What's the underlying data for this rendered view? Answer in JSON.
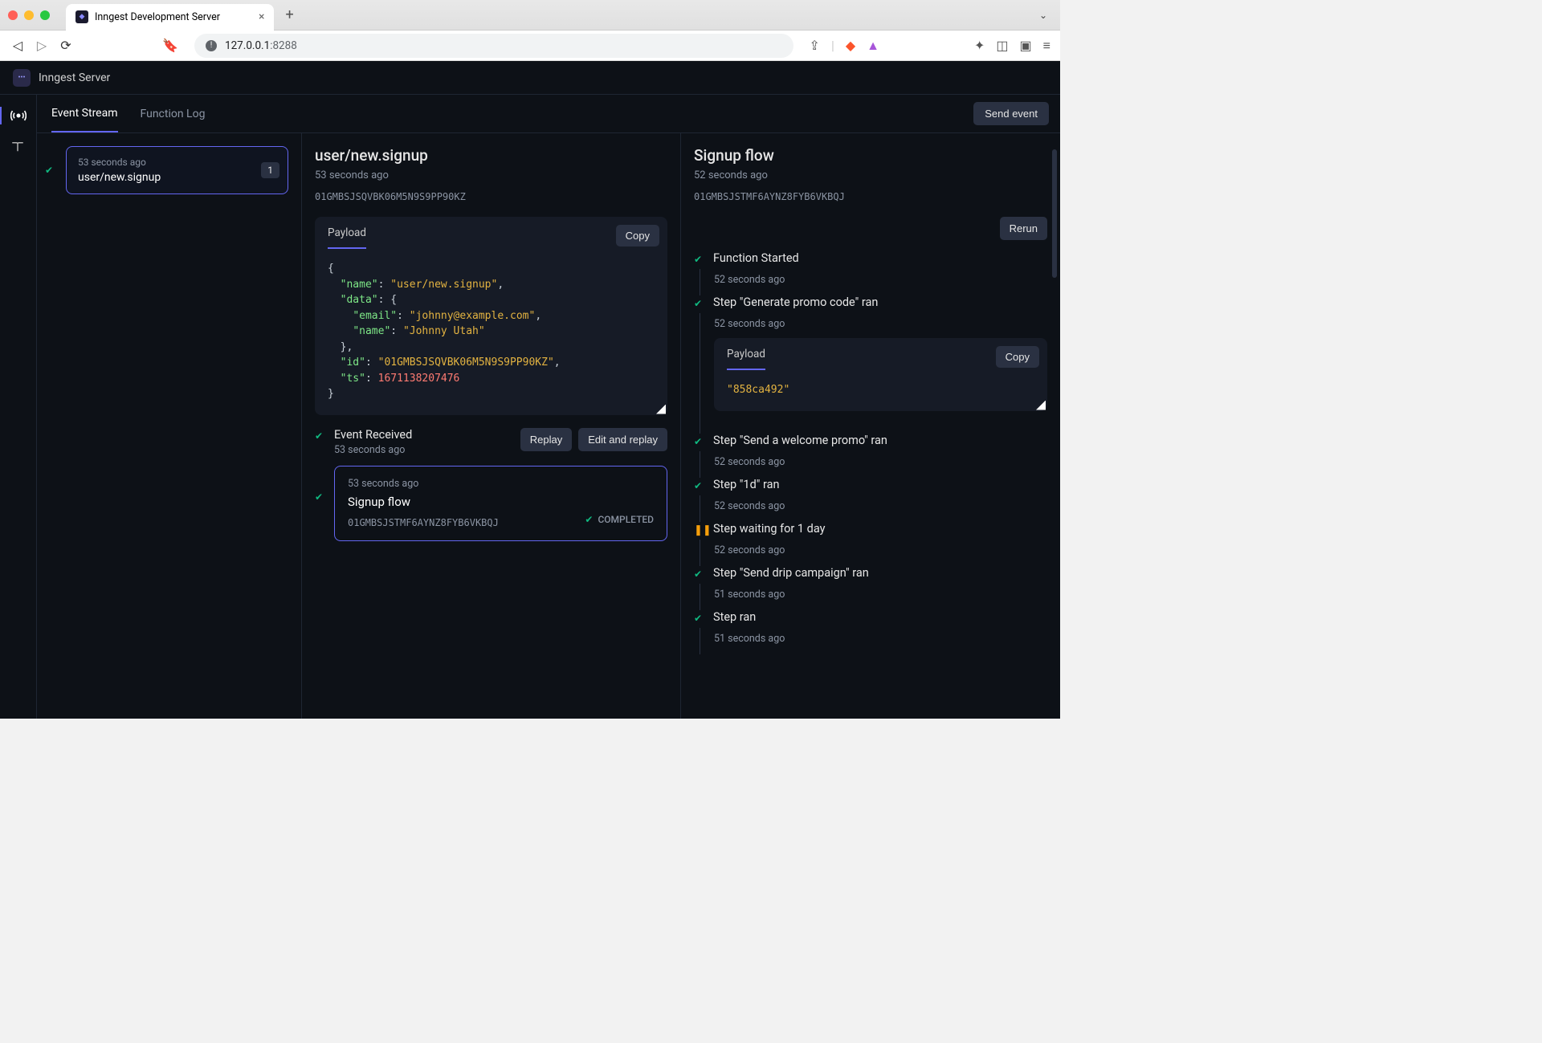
{
  "browser": {
    "tab_title": "Inngest Development Server",
    "url_host": "127.0.0.1",
    "url_port": ":8288"
  },
  "app": {
    "title": "Inngest Server",
    "tabs": {
      "events": "Event Stream",
      "functions": "Function Log"
    },
    "send_event": "Send event"
  },
  "event_list": {
    "item": {
      "time": "53 seconds ago",
      "name": "user/new.signup",
      "count": "1"
    }
  },
  "event_panel": {
    "title": "user/new.signup",
    "time": "53 seconds ago",
    "id": "01GMBSJSQVBK06M5N9S9PP90KZ",
    "code_tab": "Payload",
    "copy": "Copy",
    "payload": {
      "name_key": "\"name\"",
      "name_val": "\"user/new.signup\"",
      "data_key": "\"data\"",
      "email_key": "\"email\"",
      "email_val": "\"johnny@example.com\"",
      "pname_key": "\"name\"",
      "pname_val": "\"Johnny Utah\"",
      "id_key": "\"id\"",
      "id_val": "\"01GMBSJSQVBK06M5N9S9PP90KZ\"",
      "ts_key": "\"ts\"",
      "ts_val": "1671138207476"
    },
    "received": {
      "title": "Event Received",
      "time": "53 seconds ago",
      "replay": "Replay",
      "edit": "Edit and replay"
    },
    "flow_card": {
      "time": "53 seconds ago",
      "name": "Signup flow",
      "id": "01GMBSJSTMF6AYNZ8FYB6VKBQJ",
      "status": "COMPLETED"
    }
  },
  "run_panel": {
    "title": "Signup flow",
    "time": "52 seconds ago",
    "id": "01GMBSJSTMF6AYNZ8FYB6VKBQJ",
    "rerun": "Rerun",
    "code_tab": "Payload",
    "copy": "Copy",
    "payload_val": "\"858ca492\"",
    "steps": [
      {
        "icon": "check",
        "title": "Function Started",
        "time": "52 seconds ago"
      },
      {
        "icon": "check",
        "title": "Step \"Generate promo code\" ran",
        "time": "52 seconds ago",
        "has_payload": true
      },
      {
        "icon": "check",
        "title": "Step \"Send a welcome promo\" ran",
        "time": "52 seconds ago"
      },
      {
        "icon": "check",
        "title": "Step \"1d\" ran",
        "time": "52 seconds ago"
      },
      {
        "icon": "pause",
        "title": "Step waiting for 1 day",
        "time": "52 seconds ago"
      },
      {
        "icon": "check",
        "title": "Step \"Send drip campaign\" ran",
        "time": "51 seconds ago"
      },
      {
        "icon": "check",
        "title": "Step ran",
        "time": "51 seconds ago"
      }
    ]
  }
}
